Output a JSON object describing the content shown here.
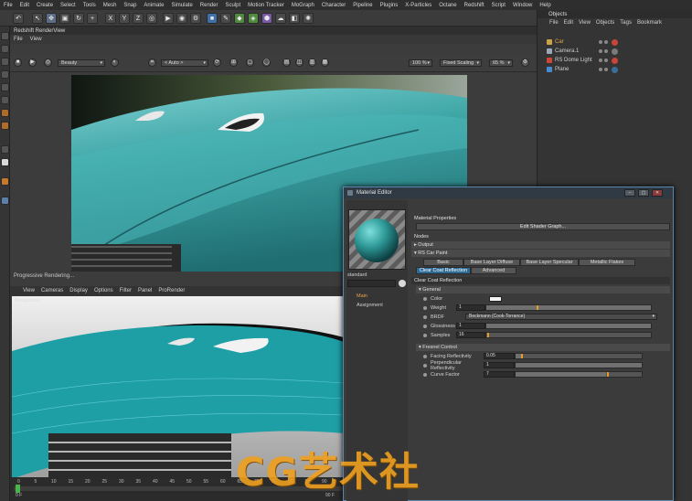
{
  "main_menu": [
    "File",
    "Edit",
    "Create",
    "Select",
    "Tools",
    "Mesh",
    "Snap",
    "Animate",
    "Simulate",
    "Render",
    "Sculpt",
    "Motion Tracker",
    "MoGraph",
    "Character",
    "Pipeline",
    "Plugins",
    "X-Particles",
    "Octane",
    "Redshift",
    "Script",
    "Window",
    "Help"
  ],
  "toolbar": {
    "axis_x": "X",
    "axis_y": "Y",
    "axis_z": "Z"
  },
  "render_view": {
    "title": "Redshift RenderView",
    "menu": [
      "File",
      "View"
    ],
    "aov": "Beauty",
    "camera": "< Auto >",
    "zoom": "100 %",
    "scaling": "Fixed Scaling",
    "scale": "65 %",
    "status": "Progressive Rendering..."
  },
  "viewport": {
    "menu": [
      "View",
      "Cameras",
      "Display",
      "Options",
      "Filter",
      "Panel",
      "ProRender"
    ],
    "label": "Perspective"
  },
  "timeline": {
    "start_frame": "0",
    "ticks": [
      "0",
      "5",
      "10",
      "15",
      "20",
      "25",
      "30",
      "35",
      "40",
      "45",
      "50",
      "55",
      "60",
      "65",
      "70",
      "75",
      "80",
      "85",
      "90"
    ],
    "current": "0 F",
    "end": "90 F"
  },
  "object_manager": {
    "title": "Objects",
    "menu": [
      "File",
      "Edit",
      "View",
      "Objects",
      "Tags",
      "Bookmark"
    ],
    "objects": [
      {
        "name": "Car",
        "color": "#c9a24a"
      },
      {
        "name": "Camera.1",
        "color": "#9aa8b8"
      },
      {
        "name": "RS Dome Light",
        "color": "#d0453a"
      },
      {
        "name": "Plane",
        "color": "#4a8ad0"
      }
    ]
  },
  "material_editor": {
    "title": "Material Editor",
    "material_name": "standard",
    "channels": [
      "Main",
      "Assignment"
    ],
    "properties_header": "Material Properties",
    "edit_button": "Edit Shader Graph...",
    "nodes_header": "Nodes",
    "nodes": [
      "Output",
      "RS Car Paint"
    ],
    "tabs_row1": [
      "Basic",
      "Base Layer Diffuse",
      "Base Layer Specular",
      "Metallic Flakes"
    ],
    "tabs_row2": [
      "Clear Coat Reflection",
      "Advanced"
    ],
    "section": "Clear Coat Reflection",
    "general_header": "General",
    "general": [
      {
        "label": "Color",
        "type": "color",
        "value": ""
      },
      {
        "label": "Weight",
        "value": "1",
        "fill": 1.0
      },
      {
        "label": "BRDF",
        "type": "select",
        "value": "Beckmann (Cook-Torrance)"
      },
      {
        "label": "Glossiness",
        "value": "1",
        "fill": 1.0
      },
      {
        "label": "Samples",
        "value": "16",
        "fill": 0.0
      }
    ],
    "fresnel_header": "Fresnel Control",
    "fresnel": [
      {
        "label": "Facing Reflectivity",
        "value": "0.05",
        "fill": 0.05
      },
      {
        "label": "Perpendicular Reflectivity",
        "value": "1",
        "fill": 1.0
      },
      {
        "label": "Curve Factor",
        "value": "7",
        "fill": 0.72
      }
    ]
  },
  "watermark": "CG艺术社",
  "colors": {
    "accent_tab": "#2e6a96",
    "slider_knob": "#e59b2a",
    "car_paint": "#3fa6a6"
  }
}
